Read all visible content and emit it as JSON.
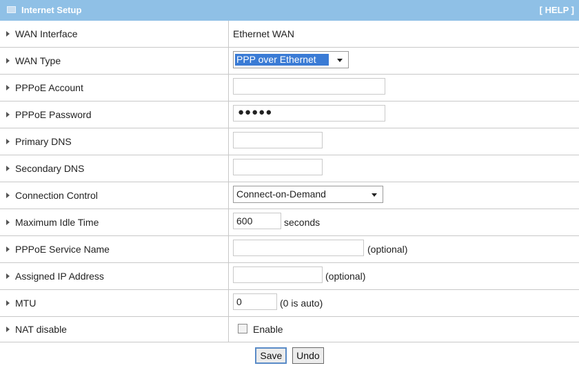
{
  "header": {
    "title": "Internet Setup",
    "help": "[ HELP ]",
    "icon": "panel-icon"
  },
  "rows": {
    "wan_interface": {
      "label": "WAN Interface",
      "value": "Ethernet WAN"
    },
    "wan_type": {
      "label": "WAN Type",
      "selected": "PPP over Ethernet"
    },
    "pppoe_account": {
      "label": "PPPoE Account",
      "value": ""
    },
    "pppoe_password": {
      "label": "PPPoE Password",
      "value": "●●●●●"
    },
    "primary_dns": {
      "label": "Primary DNS",
      "value": ""
    },
    "secondary_dns": {
      "label": "Secondary DNS",
      "value": ""
    },
    "connection_control": {
      "label": "Connection Control",
      "selected": "Connect-on-Demand"
    },
    "max_idle": {
      "label": "Maximum Idle Time",
      "value": "600",
      "suffix": "seconds"
    },
    "service_name": {
      "label": "PPPoE Service Name",
      "value": "",
      "suffix": "(optional)"
    },
    "assigned_ip": {
      "label": "Assigned IP Address",
      "value": "",
      "suffix": "(optional)"
    },
    "mtu": {
      "label": "MTU",
      "value": "0",
      "suffix": "(0 is auto)"
    },
    "nat": {
      "label": "NAT disable",
      "checkbox_label": "Enable",
      "checked": false
    }
  },
  "buttons": {
    "save": "Save",
    "undo": "Undo"
  },
  "colors": {
    "header_bg": "#8fc0e6",
    "border": "#c8c8c8",
    "select_highlight": "#3a7bd5"
  }
}
